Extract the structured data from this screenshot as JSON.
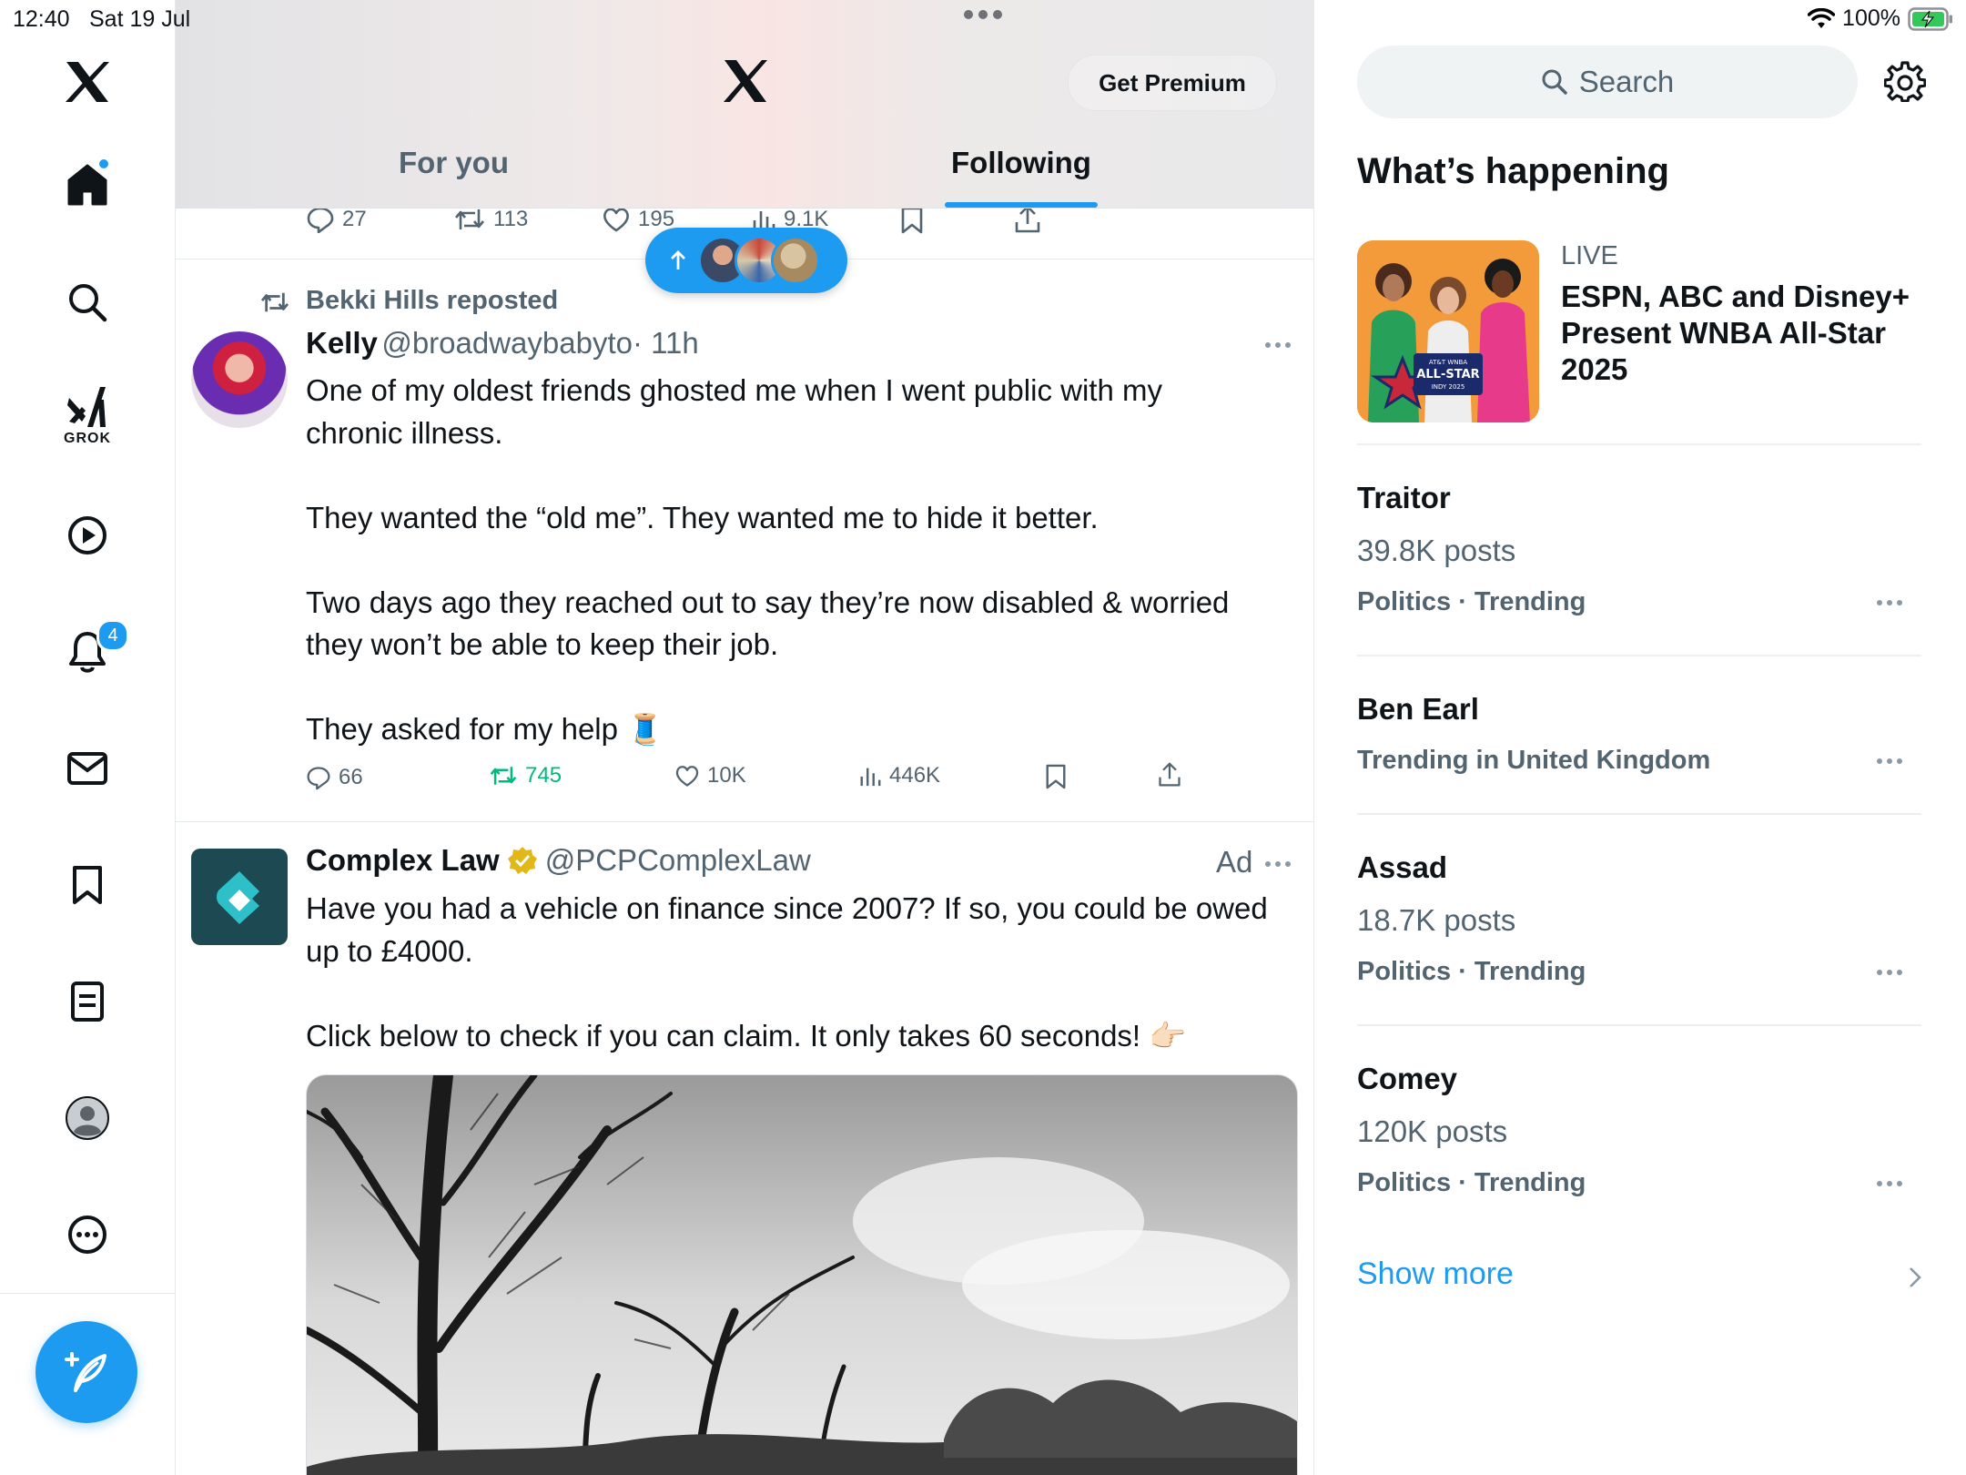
{
  "status_bar": {
    "time": "12:40",
    "date": "Sat 19 Jul",
    "battery": "100%"
  },
  "nav": {
    "items": [
      {
        "icon": "x-logo-icon"
      },
      {
        "icon": "home-icon"
      },
      {
        "icon": "search-icon"
      },
      {
        "icon": "grok-icon",
        "label": "GROK"
      },
      {
        "icon": "play-circle-icon"
      },
      {
        "icon": "bell-icon",
        "badge": "4"
      },
      {
        "icon": "mail-icon"
      },
      {
        "icon": "bookmark-icon"
      },
      {
        "icon": "lists-icon"
      },
      {
        "icon": "profile-icon"
      },
      {
        "icon": "more-circle-icon"
      }
    ],
    "compose_icon": "compose-icon"
  },
  "header": {
    "premium": "Get Premium",
    "tabs": [
      {
        "label": "For you",
        "active": false
      },
      {
        "label": "Following",
        "active": true
      }
    ]
  },
  "prev_tweet_actions": {
    "replies": "27",
    "reposts": "113",
    "likes": "195",
    "views": "9.1K"
  },
  "tweets": [
    {
      "repost_by": "Bekki Hills reposted",
      "name": "Kelly",
      "handle": "@broadwaybabyto",
      "time": "· 11h",
      "text": "One of my oldest friends ghosted me when I went public with my\nchronic illness.\n\nThey wanted the “old me”. They wanted me to hide it better.\n\nTwo days ago they reached out to say they’re now disabled & worried\nthey won’t be able to keep their job.\n\nThey asked for my help 🧵",
      "replies": "66",
      "reposts": "745",
      "likes": "10K",
      "views": "446K"
    },
    {
      "name": "Complex Law",
      "handle": "@PCPComplexLaw",
      "ad_label": "Ad",
      "text": "Have you had a vehicle on finance since 2007? If so, you could be owed\nup to £4000.\n\nClick below to check if you can claim. It only takes 60 seconds! 👉🏻"
    }
  ],
  "sidebar": {
    "search_placeholder": "Search",
    "heading": "What’s happening",
    "featured": {
      "tag": "LIVE",
      "title": "ESPN, ABC and Disney+ Present WNBA All-Star 2025",
      "image_text": {
        "line1": "AT&T WNBA",
        "line2": "ALL-STAR",
        "line3": "INDY 2025"
      }
    },
    "trends": [
      {
        "name": "Traitor",
        "posts": "39.8K posts",
        "meta": "Politics · Trending"
      },
      {
        "name": "Ben Earl",
        "meta": "Trending in United Kingdom"
      },
      {
        "name": "Assad",
        "posts": "18.7K posts",
        "meta": "Politics · Trending"
      },
      {
        "name": "Comey",
        "posts": "120K posts",
        "meta": "Politics · Trending"
      }
    ],
    "show_more": "Show more"
  },
  "colors": {
    "accent": "#1d9bf0",
    "repost_active": "#00ba7c",
    "text_secondary": "#536471"
  }
}
